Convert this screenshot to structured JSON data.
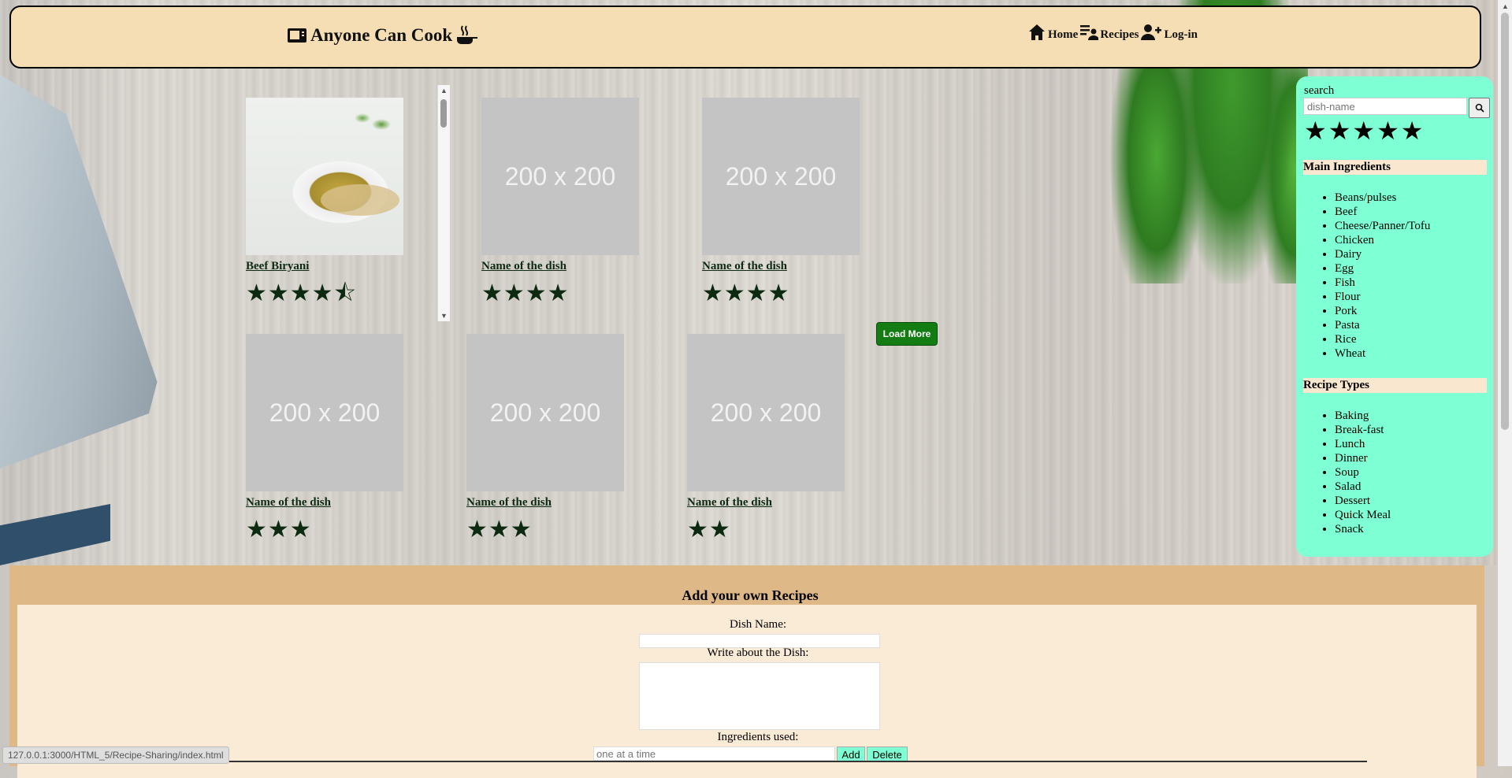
{
  "header": {
    "brand": "Anyone Can Cook",
    "nav": [
      {
        "label": "Home",
        "icon": "home-icon"
      },
      {
        "label": "Recipes",
        "icon": "recipes-icon"
      },
      {
        "label": "Log-in",
        "icon": "add-user-icon"
      }
    ]
  },
  "cards": [
    {
      "title": "Beef Biryani",
      "image": "photo",
      "rating": 4.5,
      "stars": "★★★★⯪"
    },
    {
      "title": "Name of the dish",
      "image_text": "200 x 200",
      "rating": 4,
      "stars": "★★★★"
    },
    {
      "title": "Name of the dish",
      "image_text": "200 x 200",
      "rating": 4,
      "stars": "★★★★"
    },
    {
      "title": "Name of the dish",
      "image_text": "200 x 200",
      "rating": 3,
      "stars": "★★★"
    },
    {
      "title": "Name of the dish",
      "image_text": "200 x 200",
      "rating": 3,
      "stars": "★★★"
    },
    {
      "title": "Name of the dish",
      "image_text": "200 x 200",
      "rating": 2,
      "stars": "★★"
    }
  ],
  "load_more": "Load More",
  "sidebar": {
    "search_label": "search",
    "search_placeholder": "dish-name",
    "search_button_icon": "search-icon",
    "rating_filter": 5,
    "rating_stars": "★★★★★",
    "main_ingredients_title": "Main Ingredients",
    "main_ingredients": [
      "Beans/pulses",
      "Beef",
      "Cheese/Panner/Tofu",
      "Chicken",
      "Dairy",
      "Egg",
      "Fish",
      "Flour",
      "Pork",
      "Pasta",
      "Rice",
      "Wheat"
    ],
    "recipe_types_title": "Recipe Types",
    "recipe_types": [
      "Baking",
      "Break-fast",
      "Lunch",
      "Dinner",
      "Soup",
      "Salad",
      "Dessert",
      "Quick Meal",
      "Snack"
    ]
  },
  "add_recipe": {
    "title": "Add your own Recipes",
    "dish_name_label": "Dish Name:",
    "dish_name_value": "",
    "about_label": "Write about the Dish:",
    "about_value": "",
    "ingredients_label": "Ingredients used:",
    "ingredients_placeholder": "one at a time",
    "add_button": "Add",
    "delete_button": "Delete"
  },
  "status_bar_url": "127.0.0.1:3000/HTML_5/Recipe-Sharing/index.html"
}
